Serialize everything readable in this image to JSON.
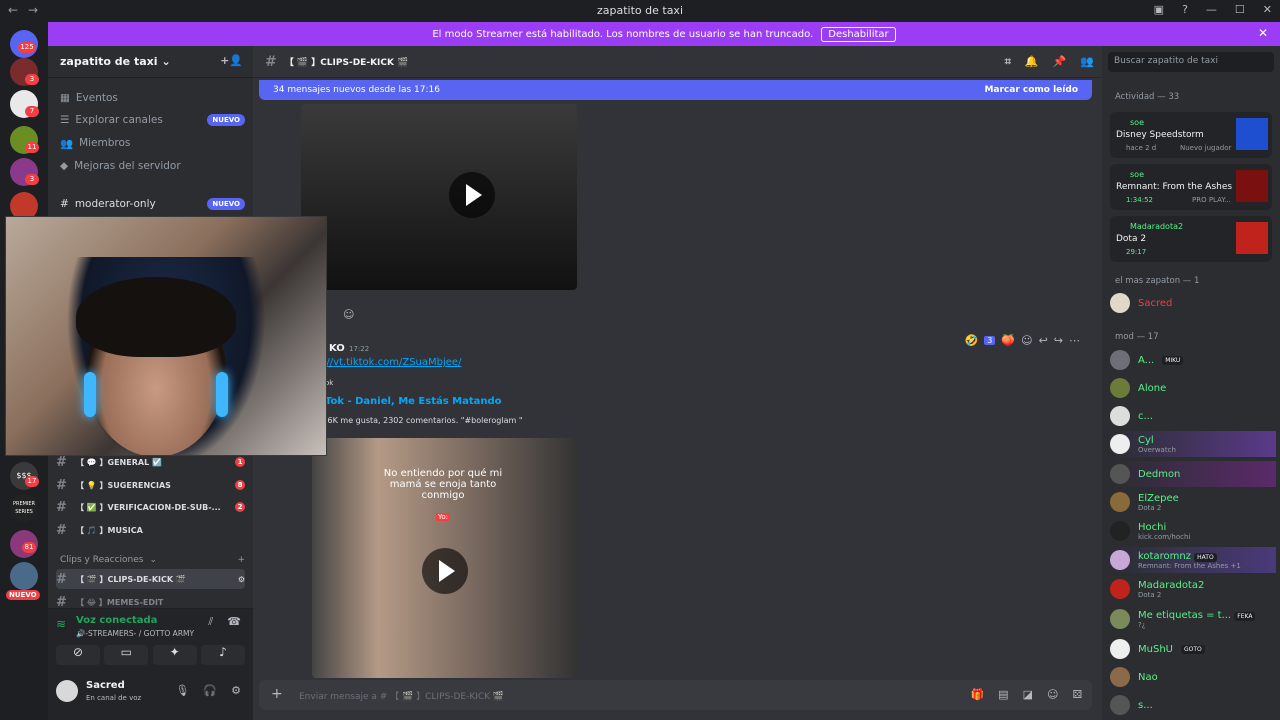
{
  "window": {
    "title": "zapatito de taxi"
  },
  "banner": {
    "text": "El modo Streamer está habilitado. Los nombres de usuario se han truncado.",
    "button": "Deshabilitar"
  },
  "guilds": {
    "home_badge": "125",
    "badges": [
      "3",
      "7",
      "11",
      "3",
      "17",
      "81"
    ],
    "new_label": "NUEVO",
    "premier_label": "PREMIER SERIES"
  },
  "server": {
    "name": "zapatito de taxi",
    "nav": [
      {
        "label": "Eventos"
      },
      {
        "label": "Explorar canales",
        "badge": "NUEVO"
      },
      {
        "label": "Miembros"
      },
      {
        "label": "Mejoras del servidor"
      }
    ],
    "moderator_channel": {
      "label": "moderator-only",
      "badge": "NUEVO"
    },
    "channels": [
      {
        "label": "【 💬 】GENERAL ☑️",
        "count": "1"
      },
      {
        "label": "【 💡 】SUGERENCIAS",
        "count": "8"
      },
      {
        "label": "【 ✅ 】VERIFICACION-DE-SUB-...",
        "count": "2"
      },
      {
        "label": "【 🎵 】MUSICA",
        "count": ""
      }
    ],
    "category": "Clips y Reacciones",
    "active_channel": "【 🎬 】CLIPS-DE-KICK 🎬",
    "next_channel": "【 😂 】MEMES-EDIT"
  },
  "voice": {
    "status": "Voz conectada",
    "channel": "🔊-STREAMERS- / GOTTO ARMY"
  },
  "user": {
    "name": "Sacred",
    "status": "En canal de voz"
  },
  "channel": {
    "name": "【 🎬 】CLIPS-DE-KICK 🎬",
    "new_messages": "34 mensajes nuevos desde las 17:16",
    "mark_read": "Marcar como leído",
    "message": {
      "author": "KO",
      "time": "17:22",
      "link": "://vt.tiktok.com/ZSuaMbjee/",
      "embed_site": "ok",
      "embed_title": "Tok - Daniel, Me Estás Matando",
      "embed_desc": ".6K me gusta, 2302 comentarios. \"#boleroglam \"",
      "video_caption": "No entiendo por qué mi mamá se enoja tanto conmigo",
      "video_tag": "Yo:"
    },
    "reaction_count": "3",
    "composer_placeholder": "Enviar mensaje a # 【 🎬 】CLIPS-DE-KICK 🎬"
  },
  "members": {
    "search_placeholder": "Buscar zapatito de taxi",
    "activity_header": "Actividad — 33",
    "activities": [
      {
        "user": "soe",
        "game": "Disney Speedstorm",
        "detail": "hace 2 d",
        "extra": "Nuevo jugador"
      },
      {
        "user": "soe",
        "game": "Remnant: From the Ashes",
        "detail": "1:34:52",
        "extra": "PRO PLAY..."
      },
      {
        "user": "Madaradota2",
        "game": "Dota 2",
        "detail": "29:17",
        "extra": ""
      }
    ],
    "section_mas": "el mas zapaton — 1",
    "mas_members": [
      {
        "name": "Sacred",
        "sub": ""
      }
    ],
    "section_mod": "mod — 17",
    "mods": [
      {
        "name": "A...",
        "sub": "",
        "tag": "MIKU"
      },
      {
        "name": "Alone",
        "sub": "",
        "tag": ""
      },
      {
        "name": "c...",
        "sub": "",
        "tag": ""
      },
      {
        "name": "Cyl",
        "sub": "Overwatch",
        "tag": ""
      },
      {
        "name": "Dedmon",
        "sub": "",
        "tag": ""
      },
      {
        "name": "ElZepee",
        "sub": "Dota 2",
        "tag": ""
      },
      {
        "name": "Hochi",
        "sub": "kick.com/hochi",
        "tag": ""
      },
      {
        "name": "kotaromnz",
        "sub": "Remnant: From the Ashes +1",
        "tag": "HATO"
      },
      {
        "name": "Madaradota2",
        "sub": "Dota 2",
        "tag": ""
      },
      {
        "name": "Me etiquetas = t...",
        "sub": "?¿",
        "tag": "FEKA"
      },
      {
        "name": "MuShU",
        "sub": "",
        "tag": "GOTO"
      },
      {
        "name": "Nao",
        "sub": "",
        "tag": ""
      },
      {
        "name": "s...",
        "sub": "",
        "tag": ""
      }
    ]
  }
}
